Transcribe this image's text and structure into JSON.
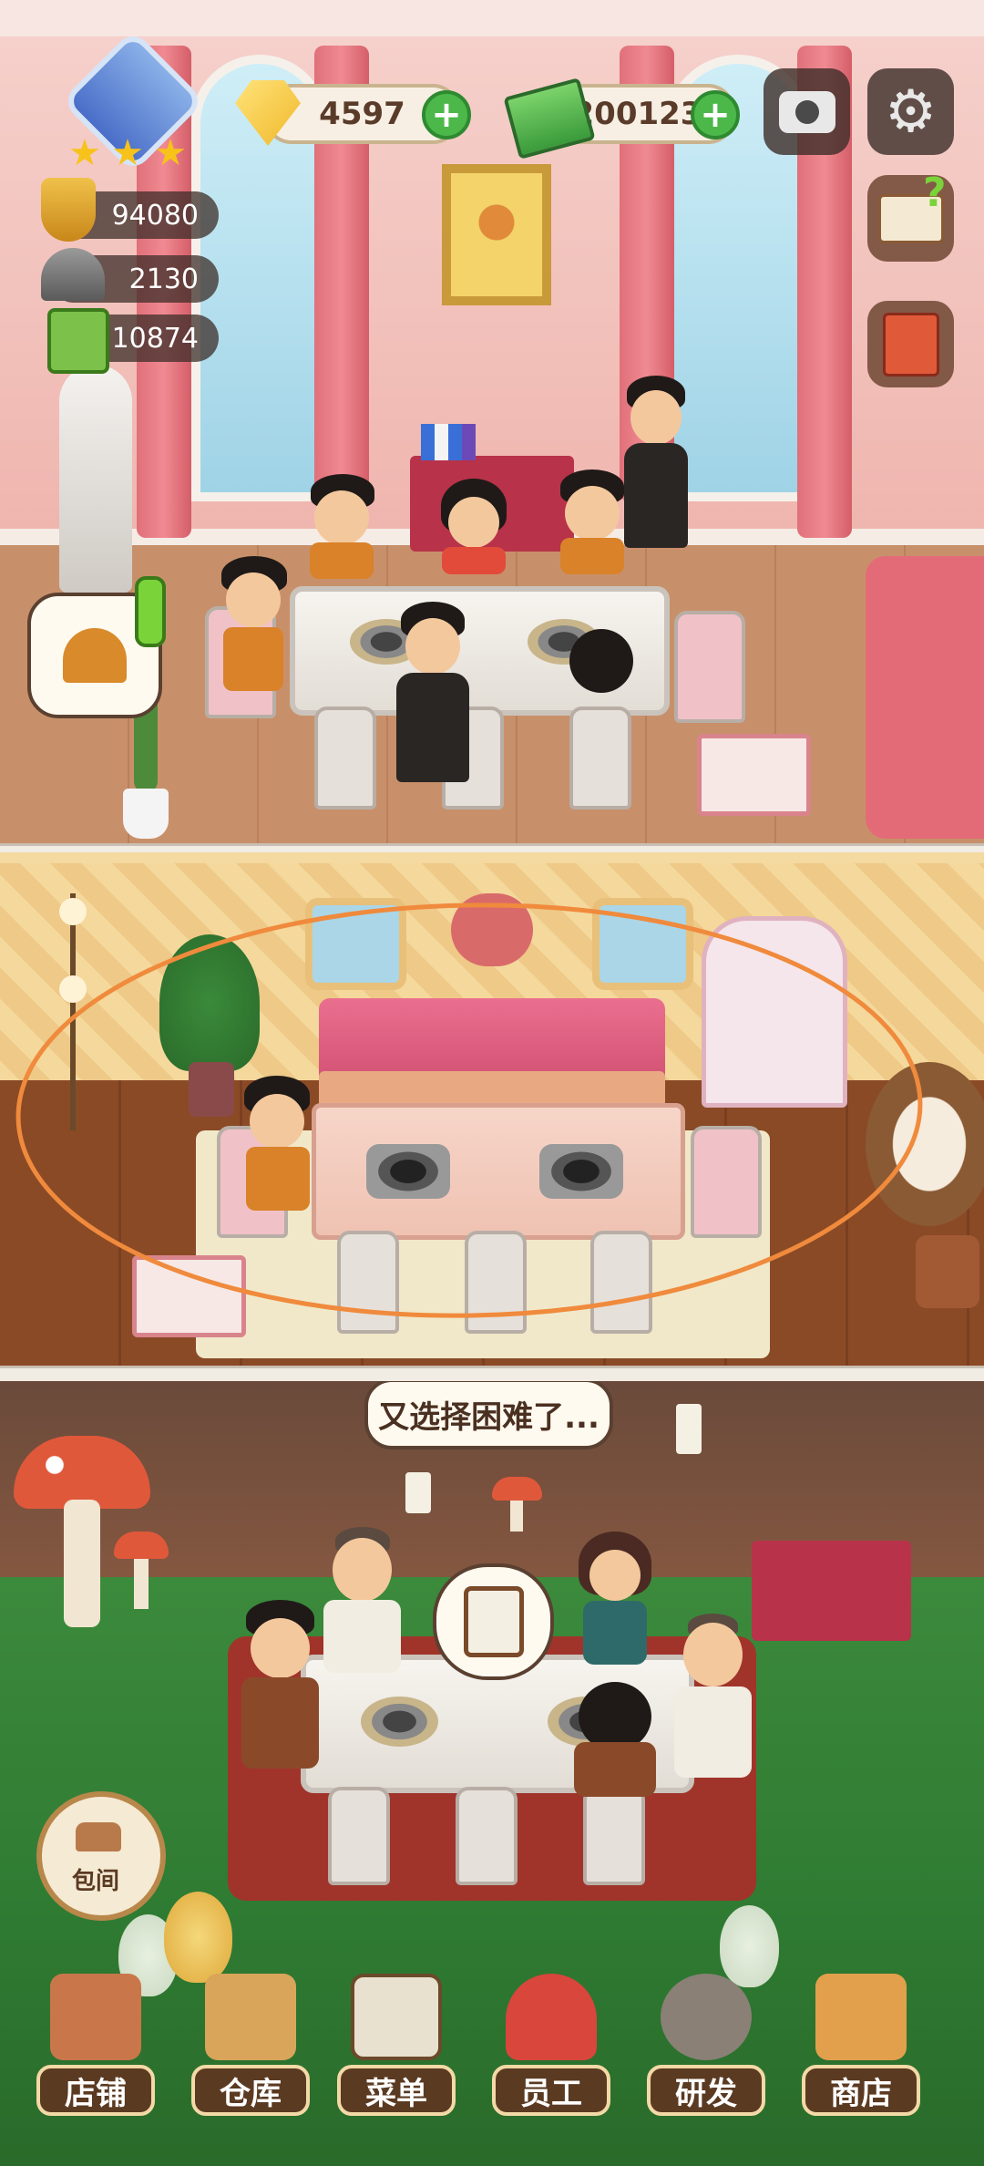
{
  "hud": {
    "level_stars": 3,
    "stats": [
      {
        "icon": "trophy-icon",
        "value": "94080"
      },
      {
        "icon": "cloche-icon",
        "value": "2130"
      },
      {
        "icon": "recipe-book-icon",
        "value": "10874"
      }
    ],
    "gems": "4597",
    "cash": "200123",
    "camera_icon": "camera-icon",
    "settings_icon": "gear-icon",
    "guide_icon": "guide-book-icon",
    "notes_icon": "notebook-icon"
  },
  "scene": {
    "notification_icon": "bell-icon",
    "speech_bubble": "又选择困难了...",
    "order_icon": "clipboard-icon"
  },
  "private_room_button": {
    "label": "包间"
  },
  "nav": [
    {
      "id": "shop",
      "label": "店铺",
      "icon": "storefront-icon",
      "color": "#c9774a"
    },
    {
      "id": "warehouse",
      "label": "仓库",
      "icon": "boxes-icon",
      "color": "#d9a55a"
    },
    {
      "id": "menu",
      "label": "菜单",
      "icon": "menu-clipboard-icon",
      "color": "#e9e1cf"
    },
    {
      "id": "staff",
      "label": "员工",
      "icon": "chef-girl-icon",
      "color": "#d8463c"
    },
    {
      "id": "research",
      "label": "研发",
      "icon": "wok-icon",
      "color": "#8a8076"
    },
    {
      "id": "store",
      "label": "商店",
      "icon": "shop-stall-icon",
      "color": "#e2a04c"
    }
  ],
  "colors": {
    "plus_button": "#4cb84a",
    "nav_label_bg": "#5b3a22",
    "selection_ring": "#f08a3c"
  }
}
